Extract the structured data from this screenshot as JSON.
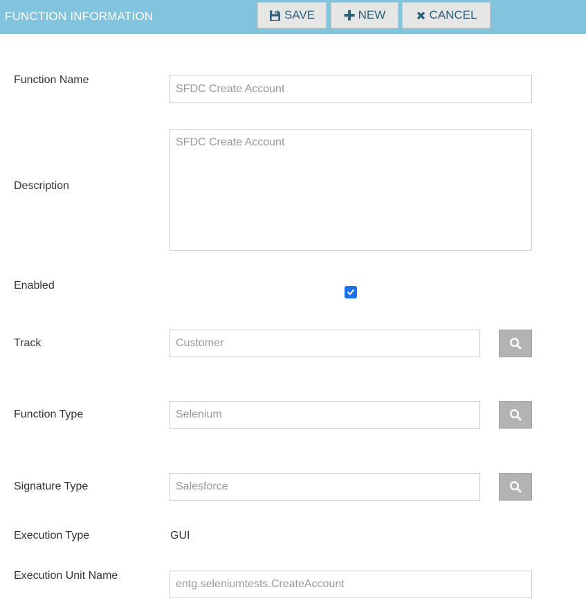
{
  "header": {
    "title": "FUNCTION INFORMATION",
    "save_label": "SAVE",
    "new_label": "NEW",
    "cancel_label": "CANCEL"
  },
  "form": {
    "function_name": {
      "label": "Function Name",
      "value": "SFDC Create Account"
    },
    "description": {
      "label": "Description",
      "value": "SFDC Create Account"
    },
    "enabled": {
      "label": "Enabled",
      "checked": true
    },
    "track": {
      "label": "Track",
      "value": "Customer"
    },
    "function_type": {
      "label": "Function Type",
      "value": "Selenium"
    },
    "signature_type": {
      "label": "Signature Type",
      "value": "Salesforce"
    },
    "execution_type": {
      "label": "Execution Type",
      "value": "GUI"
    },
    "execution_unit_name": {
      "label": "Execution Unit Name",
      "value": "entg.seleniumtests.CreateAccount"
    }
  },
  "colors": {
    "header_bg": "#82c3de",
    "button_text": "#2f5f79",
    "checkbox": "#1a73e8",
    "search_button": "#b3b3b3"
  }
}
